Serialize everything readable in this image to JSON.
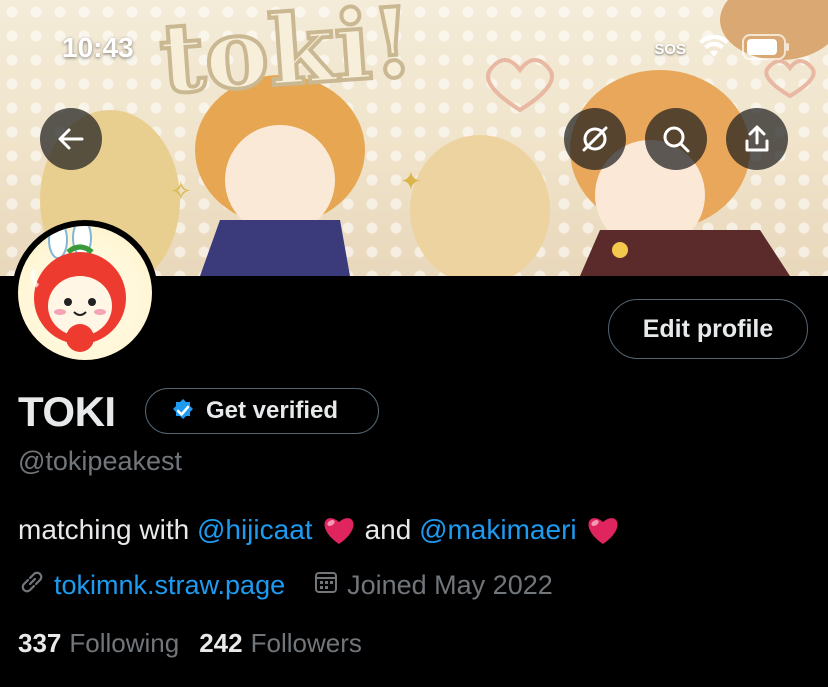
{
  "status_bar": {
    "time": "10:43",
    "sos": "SOS"
  },
  "header": {
    "banner_art_text": "toki!",
    "actions": [
      "back-arrow-icon",
      "not-following-icon",
      "search-icon",
      "share-icon"
    ]
  },
  "profile": {
    "edit_label": "Edit profile",
    "display_name": "TOKI",
    "verify_label": "Get verified",
    "handle": "@tokipeakest",
    "bio": {
      "prefix": "matching with",
      "mention_1": "@hijicaat",
      "middle": "and",
      "mention_2": "@makimaeri"
    },
    "website": "tokimnk.straw.page",
    "joined": "Joined May 2022",
    "following_count": "337",
    "following_label": "Following",
    "followers_count": "242",
    "followers_label": "Followers"
  },
  "colors": {
    "accent": "#1d9bf0",
    "background": "#000000",
    "muted": "#71767b",
    "heart": "#e0245e"
  }
}
